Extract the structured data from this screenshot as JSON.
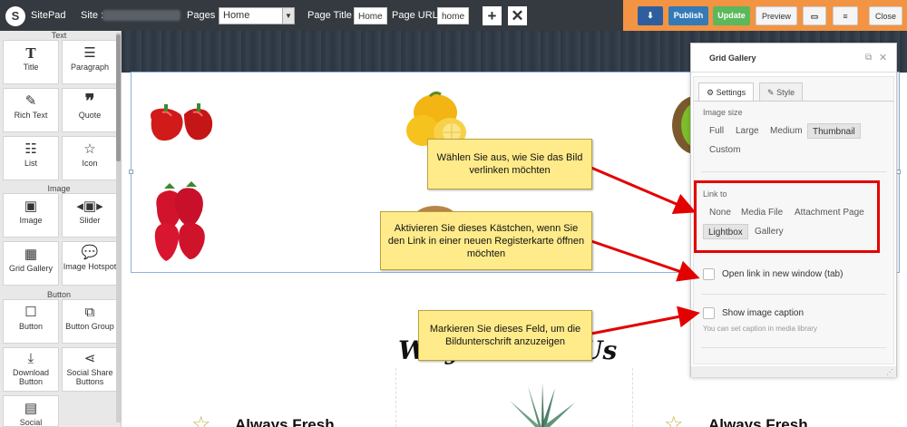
{
  "topbar": {
    "brand": "SitePad",
    "site_label": "Site :",
    "pages_label": "Pages :",
    "pages_value": "Home",
    "page_title_label": "Page Title :",
    "page_title_value": "Home",
    "page_url_label": "Page URL :",
    "page_url_value": "home",
    "publish": "Publish",
    "update": "Update",
    "preview": "Preview",
    "close": "Close"
  },
  "sidebar": {
    "sections": {
      "text": "Text",
      "image": "Image",
      "button": "Button"
    },
    "widgets": {
      "title": "Title",
      "paragraph": "Paragraph",
      "rich_text": "Rich Text",
      "quote": "Quote",
      "list": "List",
      "icon": "Icon",
      "image": "Image",
      "slider": "Slider",
      "grid_gallery": "Grid Gallery",
      "image_hotspot": "Image Hotspot",
      "button": "Button",
      "button_group": "Button Group",
      "download_button": "Download Button",
      "social_share_buttons": "Social Share Buttons",
      "social": "Social"
    }
  },
  "canvas": {
    "section_title": "Why Choose Us",
    "feature_1": "Always Fresh",
    "feature_2": "Always Fresh"
  },
  "panel": {
    "title": "Grid Gallery",
    "tabs": {
      "settings": "Settings",
      "style": "Style"
    },
    "image_size_label": "Image size",
    "image_size_options": [
      "Full",
      "Large",
      "Medium",
      "Thumbnail",
      "Custom"
    ],
    "image_size_selected": "Thumbnail",
    "link_to_label": "Link to",
    "link_to_options": [
      "None",
      "Media File",
      "Attachment Page",
      "Lightbox",
      "Gallery"
    ],
    "link_to_selected": "Lightbox",
    "open_new_window": "Open link in new window (tab)",
    "show_caption": "Show image caption",
    "caption_help": "You can set caption in media library"
  },
  "callouts": {
    "link": "Wählen Sie aus, wie Sie das Bild verlinken möchten",
    "new_tab": "Aktivieren Sie dieses Kästchen, wenn Sie den Link in einer neuen Registerkarte öffnen möchten",
    "caption": "Markieren Sie dieses Feld, um die Bildunterschrift anzuzeigen"
  },
  "colors": {
    "topbar": "#343a40",
    "orange": "#f29443",
    "publish": "#337ab7",
    "update": "#5cb85c",
    "callout": "#ffeb8a",
    "annotation_red": "#e30000"
  }
}
